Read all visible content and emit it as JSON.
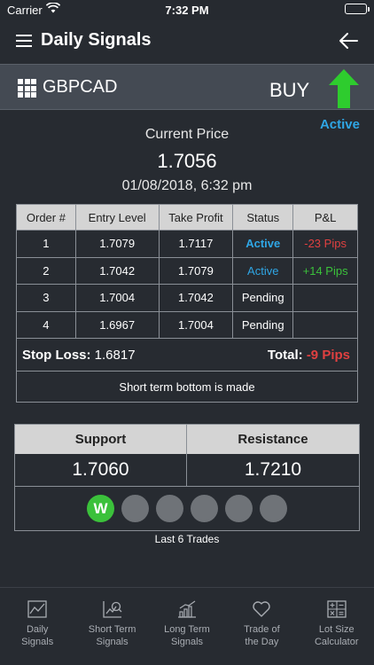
{
  "status_bar": {
    "carrier": "Carrier",
    "time": "7:32 PM"
  },
  "header": {
    "title": "Daily Signals"
  },
  "pair": {
    "symbol": "GBPCAD",
    "signal": "BUY",
    "state": "Active"
  },
  "price": {
    "label": "Current Price",
    "value": "1.7056",
    "datetime": "01/08/2018, 6:32 pm"
  },
  "orders": {
    "headers": [
      "Order #",
      "Entry Level",
      "Take Profit",
      "Status",
      "P&L"
    ],
    "rows": [
      {
        "order": "1",
        "entry": "1.7079",
        "take_profit": "1.7117",
        "status": "Active",
        "pl": "-23 Pips"
      },
      {
        "order": "2",
        "entry": "1.7042",
        "take_profit": "1.7079",
        "status": "Active",
        "pl": "+14 Pips"
      },
      {
        "order": "3",
        "entry": "1.7004",
        "take_profit": "1.7042",
        "status": "Pending",
        "pl": ""
      },
      {
        "order": "4",
        "entry": "1.6967",
        "take_profit": "1.7004",
        "status": "Pending",
        "pl": ""
      }
    ]
  },
  "summary": {
    "stop_loss_label": "Stop Loss:",
    "stop_loss_value": "1.6817",
    "total_label": "Total:",
    "total_value": "-9 Pips",
    "comment": "Short term bottom is made"
  },
  "levels": {
    "support_label": "Support",
    "resistance_label": "Resistance",
    "support": "1.7060",
    "resistance": "1.7210"
  },
  "trades": {
    "label": "Last 6 Trades",
    "results": [
      "W",
      "",
      "",
      "",
      "",
      ""
    ]
  },
  "tabs": [
    {
      "line1": "Daily",
      "line2": "Signals",
      "icon": "chart-icon"
    },
    {
      "line1": "Short Term",
      "line2": "Signals",
      "icon": "short-term-chart-icon"
    },
    {
      "line1": "Long Term",
      "line2": "Signals",
      "icon": "bar-chart-icon"
    },
    {
      "line1": "Trade of",
      "line2": "the Day",
      "icon": "heart-icon"
    },
    {
      "line1": "Lot Size",
      "line2": "Calculator",
      "icon": "calculator-icon"
    }
  ],
  "colors": {
    "background": "#272b31",
    "active": "#2fa6e5",
    "loss": "#e04040",
    "profit": "#3bc13b",
    "header_cell": "#d4d4d4",
    "buy_arrow": "#2ecc2e"
  }
}
